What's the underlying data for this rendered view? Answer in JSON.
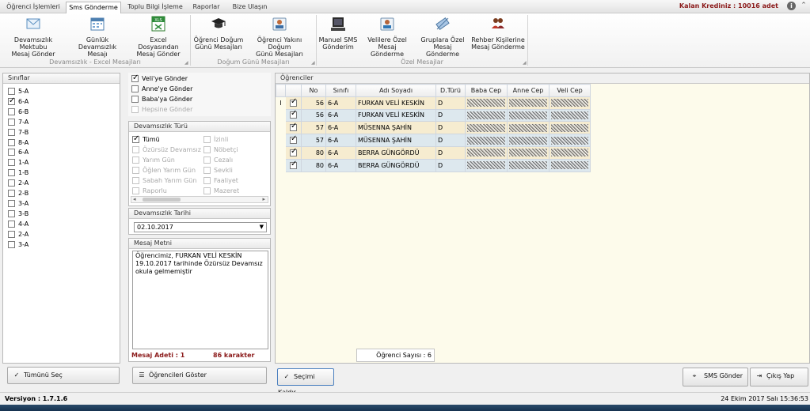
{
  "tabs": [
    "Öğrenci İşlemleri",
    "Sms Gönderme",
    "Toplu Bilgi İşleme",
    "Raporlar",
    "Bize Ulaşın"
  ],
  "credit": "Kalan Krediniz : 10016 adet",
  "ribbon": {
    "buttons": [
      {
        "label1": "Devamsızlık Mektubu",
        "label2": "Mesaj Gönder",
        "icon": "envelope-icon"
      },
      {
        "label1": "Günlük Devamsızlık",
        "label2": "Mesajı",
        "icon": "calendar-icon"
      },
      {
        "label1": "Excel Dosyasından",
        "label2": "Mesaj Gönder",
        "icon": "excel-icon"
      },
      {
        "label1": "Öğrenci Doğum",
        "label2": "Günü Mesajları",
        "icon": "graduation-cap-icon"
      },
      {
        "label1": "Öğrenci Yakını Doğum",
        "label2": "Günü Mesajları",
        "icon": "id-card-icon"
      },
      {
        "label1": "Manuel SMS",
        "label2": "Gönderim",
        "icon": "keyboard-icon"
      },
      {
        "label1": "Velilere Özel",
        "label2": "Mesaj Gönderme",
        "icon": "parent-icon"
      },
      {
        "label1": "Gruplara Özel",
        "label2": "Mesaj Gönderme",
        "icon": "satellite-icon"
      },
      {
        "label1": "Rehber Kişilerine",
        "label2": "Mesaj Gönderme",
        "icon": "contacts-icon"
      }
    ],
    "groups": [
      "Devamsızlık - Excel Mesajları",
      "Doğum Günü Mesajları",
      "Özel Mesajlar"
    ]
  },
  "classes": {
    "header": "Sınıflar",
    "items": [
      {
        "label": "5-A",
        "checked": false
      },
      {
        "label": "6-A",
        "checked": true
      },
      {
        "label": "6-B",
        "checked": false
      },
      {
        "label": "7-A",
        "checked": false
      },
      {
        "label": "7-B",
        "checked": false
      },
      {
        "label": "8-A",
        "checked": false
      },
      {
        "label": "6-A",
        "checked": false
      },
      {
        "label": "1-A",
        "checked": false
      },
      {
        "label": "1-B",
        "checked": false
      },
      {
        "label": "2-A",
        "checked": false
      },
      {
        "label": "2-B",
        "checked": false
      },
      {
        "label": "3-A",
        "checked": false
      },
      {
        "label": "3-B",
        "checked": false
      },
      {
        "label": "4-A",
        "checked": false
      },
      {
        "label": "2-A",
        "checked": false
      },
      {
        "label": "3-A",
        "checked": false
      }
    ],
    "select_all": "Tümünü Seç"
  },
  "recipients": [
    {
      "label": "Veli'ye Gönder",
      "checked": true,
      "disabled": false
    },
    {
      "label": "Anne'ye Gönder",
      "checked": false,
      "disabled": false
    },
    {
      "label": "Baba'ya Gönder",
      "checked": false,
      "disabled": false
    },
    {
      "label": "Hepsine Gönder",
      "checked": false,
      "disabled": true
    }
  ],
  "absence_type": {
    "header": "Devamsızlık Türü",
    "left": [
      {
        "label": "Tümü",
        "checked": true,
        "disabled": false
      },
      {
        "label": "Özürsüz Devamsız",
        "checked": false,
        "disabled": true
      },
      {
        "label": "Yarım Gün",
        "checked": false,
        "disabled": true
      },
      {
        "label": "Öğlen Yarım Gün",
        "checked": false,
        "disabled": true
      },
      {
        "label": "Sabah Yarım Gün",
        "checked": false,
        "disabled": true
      },
      {
        "label": "Raporlu",
        "checked": false,
        "disabled": true
      }
    ],
    "right": [
      {
        "label": "İzinli",
        "checked": false,
        "disabled": true
      },
      {
        "label": "Nöbetçi",
        "checked": false,
        "disabled": true
      },
      {
        "label": "Cezalı",
        "checked": false,
        "disabled": true
      },
      {
        "label": "Sevkli",
        "checked": false,
        "disabled": true
      },
      {
        "label": "Faaliyet",
        "checked": false,
        "disabled": true
      },
      {
        "label": "Mazeret",
        "checked": false,
        "disabled": true
      }
    ]
  },
  "absence_date": {
    "header": "Devamsızlık Tarihi",
    "value": "02.10.2017"
  },
  "message": {
    "header": "Mesaj Metni",
    "text": "Öğrencimiz, FURKAN VELİ KESKİN 19.10.2017 tarihinde Özürsüz Devamsız okula gelmemiştir",
    "count_label": "Mesaj Adeti : 1",
    "char_label": "86 karakter"
  },
  "show_students": "Öğrencileri Göster",
  "students": {
    "header": "Öğrenciler",
    "columns": [
      "No",
      "Sınıfı",
      "Adı Soyadı",
      "D.Türü",
      "Baba Cep",
      "Anne Cep",
      "Veli Cep"
    ],
    "rows": [
      {
        "checked": true,
        "no": "56",
        "class": "6-A",
        "name": "FURKAN VELİ KESKİN",
        "type": "D"
      },
      {
        "checked": true,
        "no": "56",
        "class": "6-A",
        "name": "FURKAN VELİ KESKİN",
        "type": "D"
      },
      {
        "checked": true,
        "no": "57",
        "class": "6-A",
        "name": "MÜSENNA ŞAHİN",
        "type": "D"
      },
      {
        "checked": true,
        "no": "57",
        "class": "6-A",
        "name": "MÜSENNA ŞAHİN",
        "type": "D"
      },
      {
        "checked": true,
        "no": "80",
        "class": "6-A",
        "name": "BERRA GÜNGÖRDÜ",
        "type": "D"
      },
      {
        "checked": true,
        "no": "80",
        "class": "6-A",
        "name": "BERRA GÜNGÖRDÜ",
        "type": "D"
      }
    ],
    "count_label": "Öğrenci Sayısı : 6"
  },
  "buttons": {
    "clear": "Seçimi Kaldır",
    "send": "SMS Gönder",
    "exit": "Çıkış Yap"
  },
  "status": {
    "version": "Versiyon : 1.7.1.6",
    "datetime": "24 Ekim 2017 Salı 15:36:53"
  }
}
